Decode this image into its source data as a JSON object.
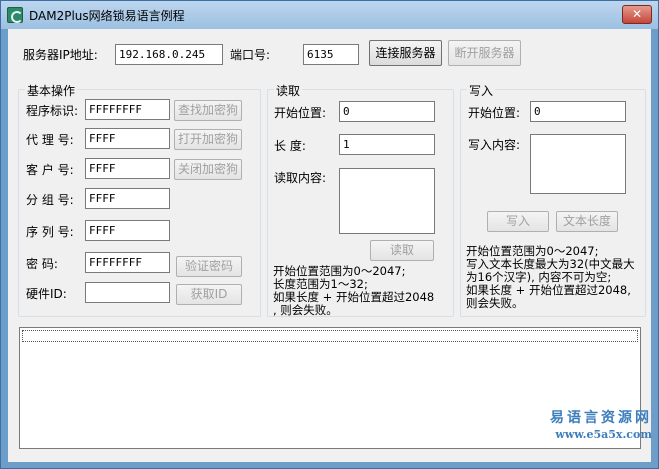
{
  "window": {
    "title": "DAM2Plus网络锁易语言例程",
    "close_glyph": "✕"
  },
  "server": {
    "ip_label": "服务器IP地址:",
    "ip_value": "192.168.0.245",
    "port_label": "端口号:",
    "port_value": "6135",
    "connect_label": "连接服务器",
    "disconnect_label": "断开服务器"
  },
  "basic": {
    "title": "基本操作",
    "program_id_label": "程序标识:",
    "program_id_value": "FFFFFFFF",
    "find_label": "查找加密狗",
    "agent_label": "代 理 号:",
    "agent_value": "FFFF",
    "open_label": "打开加密狗",
    "customer_label": "客 户 号:",
    "customer_value": "FFFF",
    "close_label": "关闭加密狗",
    "group_label": "分 组 号:",
    "group_value": "FFFF",
    "serial_label": "序 列 号:",
    "serial_value": "FFFF",
    "password_label": "密    码:",
    "password_value": "FFFFFFFF",
    "verify_label": "验证密码",
    "hardware_label": "硬件ID:",
    "hardware_value": "",
    "get_id_label": "获取ID"
  },
  "read": {
    "title": "读取",
    "start_label": "开始位置:",
    "start_value": "0",
    "length_label": "长    度:",
    "length_value": "1",
    "content_label": "读取内容:",
    "read_button": "读取",
    "note_lines": [
      "开始位置范围为0～2047;",
      "长度范围为1～32;",
      "如果长度 + 开始位置超过2048",
      ", 则会失败。"
    ]
  },
  "write": {
    "title": "写入",
    "start_label": "开始位置:",
    "start_value": "0",
    "content_label": "写入内容:",
    "write_button": "写入",
    "length_button": "文本长度",
    "note_lines": [
      "开始位置范围为0～2047;",
      "写入文本长度最大为32(中文最大",
      "为16个汉字), 内容不可为空;",
      "如果长度 + 开始位置超过2048,",
      "则会失败。"
    ]
  },
  "watermark": {
    "line1": "易语言资源网",
    "line2": "www.e5a5x.com"
  },
  "colors": {
    "title_bar": "#9cc0e2",
    "client": "#f0f0f0",
    "disabled_text": "#a0a0a0",
    "watermark": "#3d7ebd"
  }
}
